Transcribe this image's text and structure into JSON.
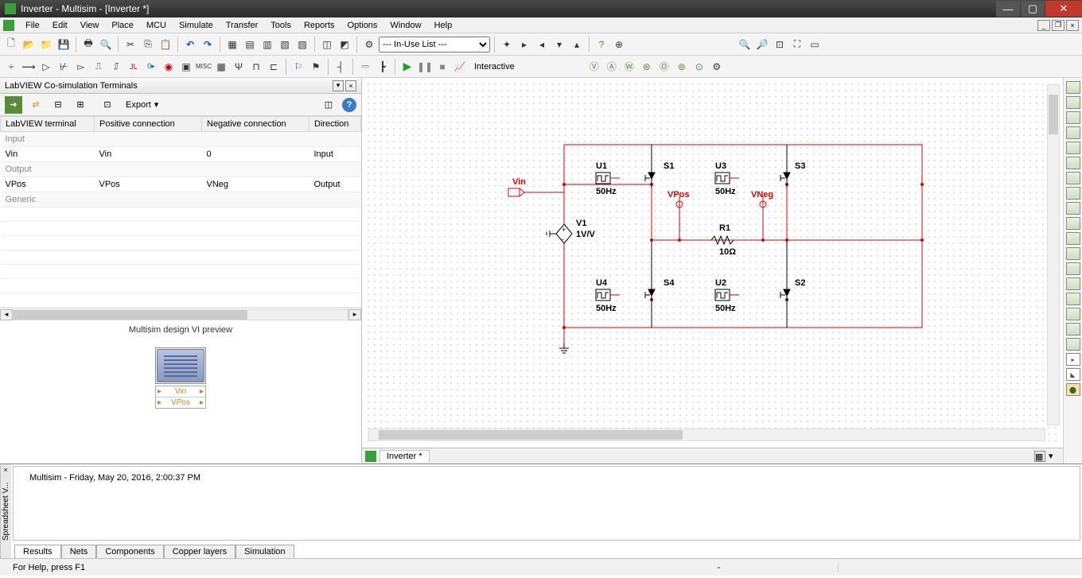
{
  "window": {
    "title": "Inverter - Multisim - [Inverter *]"
  },
  "menu": [
    "File",
    "Edit",
    "View",
    "Place",
    "MCU",
    "Simulate",
    "Transfer",
    "Tools",
    "Reports",
    "Options",
    "Window",
    "Help"
  ],
  "toolbar1": {
    "inuse": "--- In-Use List ---"
  },
  "toolbar2": {
    "mode": "Interactive"
  },
  "left_panel": {
    "title": "LabVIEW Co-simulation Terminals",
    "export": "Export",
    "columns": [
      "LabVIEW terminal",
      "Positive connection",
      "Negative connection",
      "Direction"
    ],
    "rows": [
      {
        "type": "group",
        "label": "Input"
      },
      {
        "type": "data",
        "cells": [
          "Vin",
          "Vin",
          "0",
          "Input"
        ]
      },
      {
        "type": "group",
        "label": "Output"
      },
      {
        "type": "data",
        "cells": [
          "VPos",
          "VPos",
          "VNeg",
          "Output"
        ]
      },
      {
        "type": "group",
        "label": "Generic"
      }
    ],
    "preview_label": "Multisim design VI preview",
    "preview_terms": [
      "Vin",
      "VPos"
    ]
  },
  "schematic": {
    "vin_label": "Vin",
    "v1": {
      "name": "V1",
      "val": "1V/V"
    },
    "u1": {
      "name": "U1",
      "freq": "50Hz"
    },
    "u2": {
      "name": "U2",
      "freq": "50Hz"
    },
    "u3": {
      "name": "U3",
      "freq": "50Hz"
    },
    "u4": {
      "name": "U4",
      "freq": "50Hz"
    },
    "s1": "S1",
    "s2": "S2",
    "s3": "S3",
    "s4": "S4",
    "r1": {
      "name": "R1",
      "val": "10Ω"
    },
    "vpos": "VPos",
    "vneg": "VNeg"
  },
  "doc_tab": "Inverter *",
  "spreadsheet": {
    "side": "Spreadsheet V...",
    "msg": "Multisim  -  Friday, May 20, 2016, 2:00:37 PM",
    "tabs": [
      "Results",
      "Nets",
      "Components",
      "Copper layers",
      "Simulation"
    ]
  },
  "status": {
    "help": "For Help, press F1",
    "dash": "-"
  }
}
